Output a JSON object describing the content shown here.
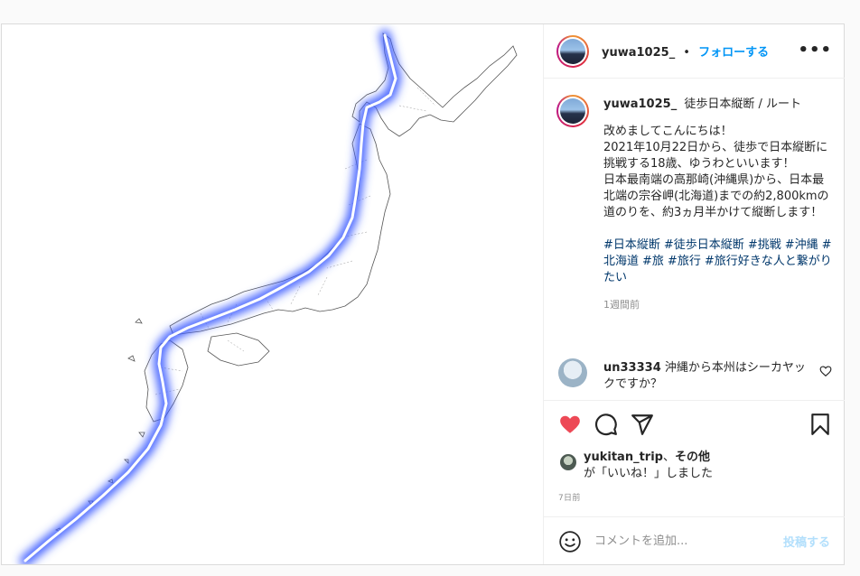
{
  "post": {
    "author": "yuwa1025_",
    "separator": "•",
    "follow_label": "フォローする",
    "more_label": "•••"
  },
  "caption": {
    "username": "yuwa1025_",
    "title": "徒歩日本縦断 / ルート",
    "body": "改めましてこんにちは！\n2021年10月22日から、徒歩で日本縦断に挑戦する18歳、ゆうわといいます！\n日本最南端の高那崎(沖縄県)から、日本最北端の宗谷岬(北海道)までの約2,800kmの道のりを、約3ヵ月半かけて縦断します！",
    "hashtags": [
      "#日本縦断",
      "#徒歩日本縦断",
      "#挑戦",
      "#沖縄",
      "#北海道",
      "#旅",
      "#旅行",
      "#旅行好きな人と繋がりたい"
    ],
    "time": "1週間前"
  },
  "reply": {
    "username": "un33334",
    "text": "沖縄から本州はシーカヤックですか？"
  },
  "likes": {
    "user": "yukitan_trip",
    "connector": "、",
    "others": "その他",
    "suffix": "が「いいね！」しました"
  },
  "date": "7日前",
  "comment_box": {
    "placeholder": "コメントを追加...",
    "post_label": "投稿する"
  },
  "colors": {
    "link_blue": "#0095f6",
    "hashtag": "#00376b",
    "like_red": "#ed4956",
    "route_glow": "#3f5fff"
  },
  "icons": [
    "emoji-icon",
    "heart-icon",
    "comment-icon",
    "share-icon",
    "bookmark-icon",
    "more-icon"
  ]
}
